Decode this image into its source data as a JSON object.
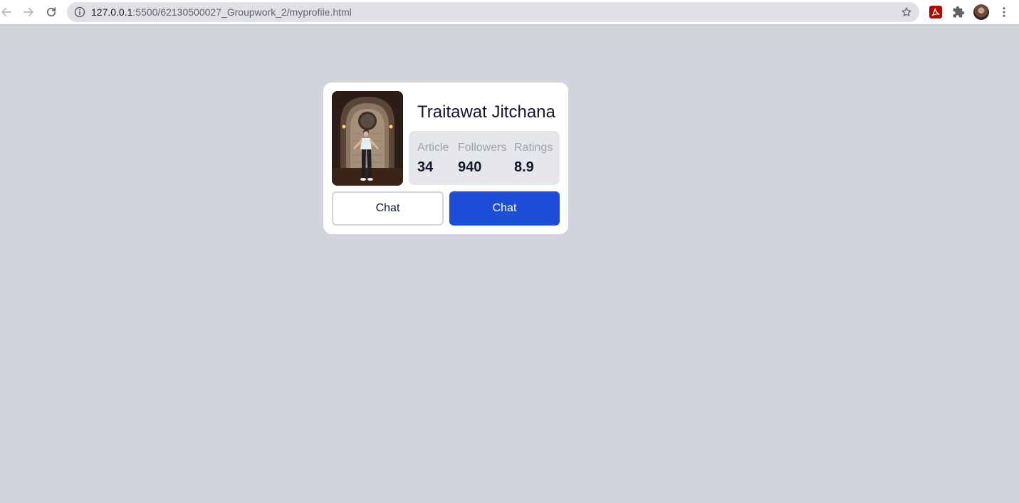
{
  "browser": {
    "url_host": "127.0.0.1",
    "url_rest": ":5500/62130500027_Groupwork_2/myprofile.html",
    "icons": {
      "back": "arrow-left-icon",
      "forward": "arrow-right-icon",
      "reload": "reload-icon",
      "info": "info-icon",
      "bookmark": "star-icon",
      "pdf_extension": "pdf-icon",
      "extensions": "puzzle-icon",
      "profile": "avatar",
      "menu": "kebab-menu-icon"
    }
  },
  "profile": {
    "name": "Traitawat Jitchana",
    "photo_icon": "profile-photo",
    "stats": [
      {
        "label": "Article",
        "value": "34"
      },
      {
        "label": "Followers",
        "value": "940"
      },
      {
        "label": "Ratings",
        "value": "8.9"
      }
    ],
    "buttons": {
      "secondary_label": "Chat",
      "primary_label": "Chat"
    }
  },
  "colors": {
    "page_background": "#d1d5db",
    "card_background": "#ffffff",
    "stats_background": "#e5e7eb",
    "primary_button": "#1d4ed8",
    "label_gray": "#9ca3af"
  }
}
